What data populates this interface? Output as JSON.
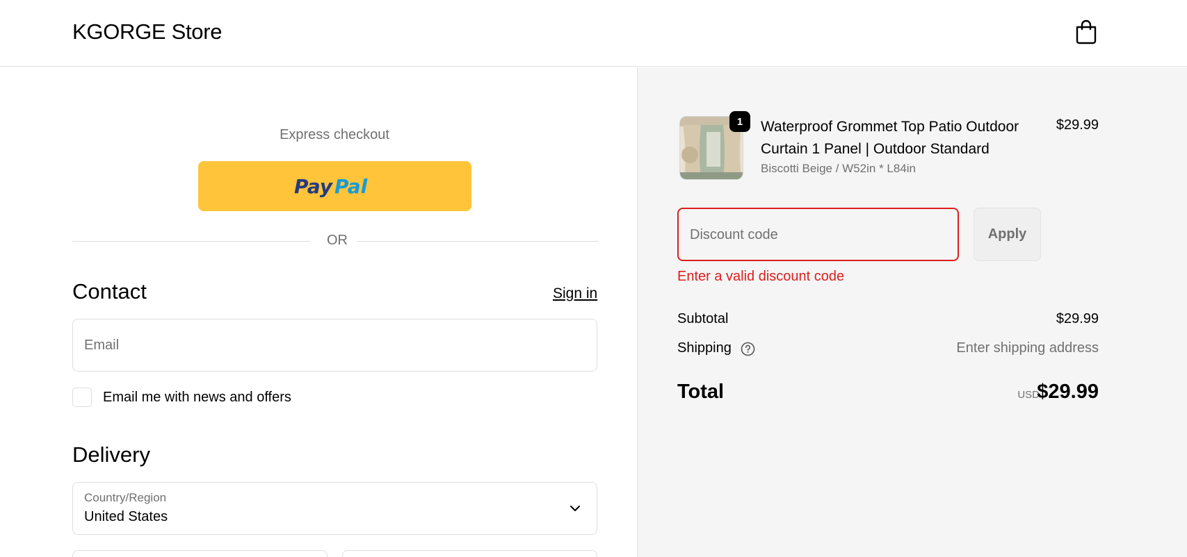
{
  "header": {
    "store_name": "KGORGE Store",
    "cart_icon": "shopping-bag-icon"
  },
  "express": {
    "label": "Express checkout",
    "paypal_label": "PayPal",
    "paypal_color": "#ffc439",
    "or_label": "OR"
  },
  "contact": {
    "title": "Contact",
    "sign_in": "Sign in",
    "email_placeholder": "Email",
    "newsletter_label": "Email me with news and offers",
    "newsletter_checked": false
  },
  "delivery": {
    "title": "Delivery",
    "country_label": "Country/Region",
    "country_value": "United States"
  },
  "order": {
    "item": {
      "quantity": "1",
      "title": "Waterproof Grommet Top Patio Outdoor Curtain 1 Panel | Outdoor Standard",
      "variant": "Biscotti Beige / W52in * L84in",
      "price": "$29.99"
    },
    "discount": {
      "placeholder": "Discount code",
      "apply_label": "Apply",
      "error": "Enter a valid discount code",
      "error_color": "#dd1d1d"
    },
    "summary": {
      "subtotal_label": "Subtotal",
      "subtotal_value": "$29.99",
      "shipping_label": "Shipping",
      "shipping_value": "Enter shipping address",
      "total_label": "Total",
      "currency": "USD",
      "total_value": "$29.99"
    }
  }
}
